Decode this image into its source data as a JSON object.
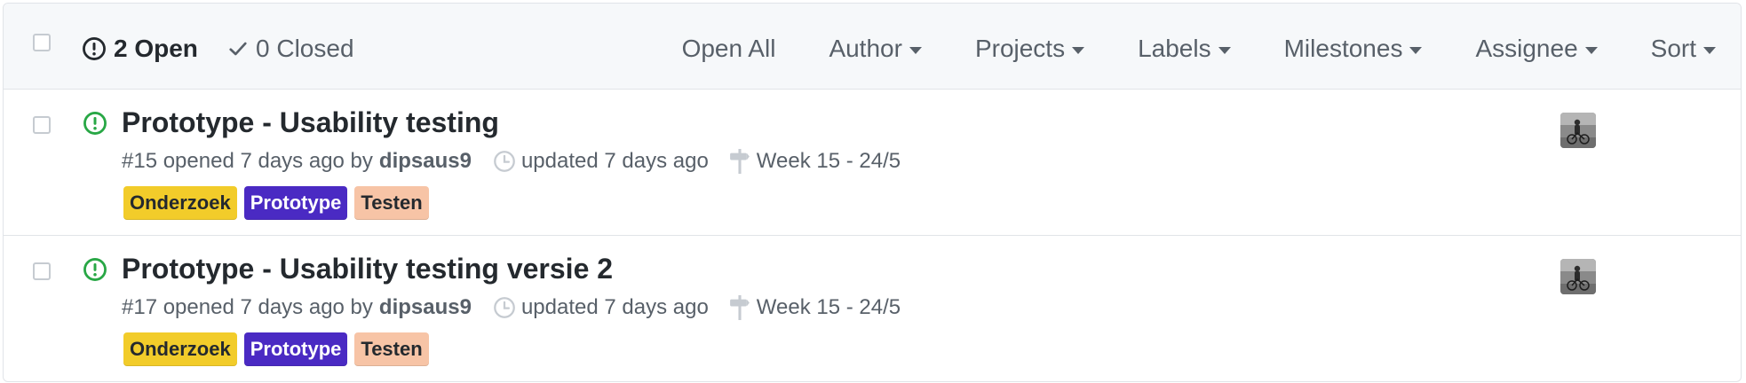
{
  "header": {
    "open_label": "2 Open",
    "closed_label": "0 Closed",
    "filters": [
      {
        "label": "Open All",
        "has_caret": false
      },
      {
        "label": "Author",
        "has_caret": true
      },
      {
        "label": "Projects",
        "has_caret": true
      },
      {
        "label": "Labels",
        "has_caret": true
      },
      {
        "label": "Milestones",
        "has_caret": true
      },
      {
        "label": "Assignee",
        "has_caret": true
      },
      {
        "label": "Sort",
        "has_caret": true
      }
    ]
  },
  "issues": [
    {
      "title": "Prototype - Usability testing",
      "opened_text": "#15 opened 7 days ago by",
      "author": "dipsaus9",
      "updated": "updated 7 days ago",
      "milestone": "Week 15 - 24/5",
      "labels": [
        {
          "name": "Onderzoek",
          "bg": "#f2cc2a",
          "fg": "#24292e"
        },
        {
          "name": "Prototype",
          "bg": "#4a2ac3",
          "fg": "#ffffff"
        },
        {
          "name": "Testen",
          "bg": "#f7c4a6",
          "fg": "#24292e"
        }
      ]
    },
    {
      "title": "Prototype - Usability testing versie 2",
      "opened_text": "#17 opened 7 days ago by",
      "author": "dipsaus9",
      "updated": "updated 7 days ago",
      "milestone": "Week 15 - 24/5",
      "labels": [
        {
          "name": "Onderzoek",
          "bg": "#f2cc2a",
          "fg": "#24292e"
        },
        {
          "name": "Prototype",
          "bg": "#4a2ac3",
          "fg": "#ffffff"
        },
        {
          "name": "Testen",
          "bg": "#f7c4a6",
          "fg": "#24292e"
        }
      ]
    }
  ],
  "colors": {
    "open_green": "#28a745",
    "muted_text": "#586069",
    "border": "#e1e4e8",
    "header_bg": "#f6f8fa"
  }
}
